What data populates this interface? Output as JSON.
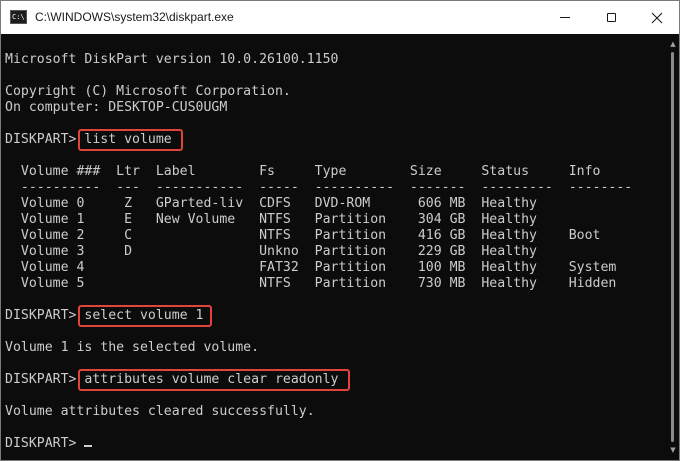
{
  "window": {
    "title": "C:\\WINDOWS\\system32\\diskpart.exe",
    "icon": "console-app-icon",
    "icon_glyph": "C:\\"
  },
  "controls": {
    "minimize_icon": "minimize-icon",
    "maximize_icon": "maximize-icon",
    "close_icon": "close-icon"
  },
  "console": {
    "lines": [
      "Microsoft DiskPart version 10.0.26100.1150",
      "",
      "Copyright (C) Microsoft Corporation.",
      "On computer: DESKTOP-CUS0UGM",
      "",
      "DISKPART> list volume",
      "",
      "  Volume ###  Ltr  Label        Fs     Type        Size     Status     Info",
      "  ----------  ---  -----------  -----  ----------  -------  ---------  --------",
      "  Volume 0     Z   GParted-liv  CDFS   DVD-ROM      606 MB  Healthy",
      "  Volume 1     E   New Volume   NTFS   Partition    304 GB  Healthy",
      "  Volume 2     C                NTFS   Partition    416 GB  Healthy    Boot",
      "  Volume 3     D                Unkno  Partition    229 GB  Healthy",
      "  Volume 4                      FAT32  Partition    100 MB  Healthy    System",
      "  Volume 5                      NTFS   Partition    730 MB  Healthy    Hidden",
      "",
      "DISKPART> select volume 1",
      "",
      "Volume 1 is the selected volume.",
      "",
      "DISKPART> attributes volume clear readonly",
      "",
      "Volume attributes cleared successfully.",
      "",
      "DISKPART> "
    ]
  },
  "colors": {
    "console_bg": "#0c0c0c",
    "console_text": "#cccccc",
    "highlight": "#e1443a",
    "titlebar_bg": "#ffffff"
  }
}
